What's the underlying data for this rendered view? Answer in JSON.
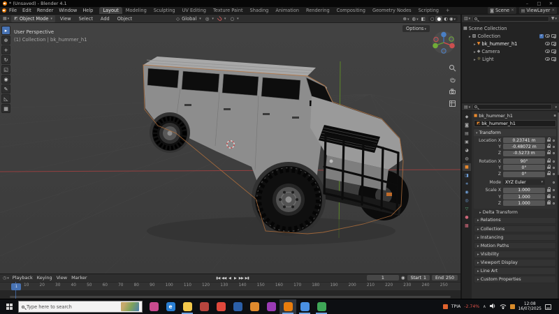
{
  "window": {
    "title": "* (Unsaved) - Blender 4.1",
    "controls": {
      "minimize": "–",
      "maximize": "□",
      "close": "✕"
    }
  },
  "menubar": {
    "menus": [
      {
        "label": "File"
      },
      {
        "label": "Edit"
      },
      {
        "label": "Render"
      },
      {
        "label": "Window"
      },
      {
        "label": "Help"
      }
    ],
    "workspaces": [
      {
        "label": "Layout",
        "cls": "active"
      },
      {
        "label": "Modeling"
      },
      {
        "label": "Sculpting"
      },
      {
        "label": "UV Editing"
      },
      {
        "label": "Texture Paint"
      },
      {
        "label": "Shading"
      },
      {
        "label": "Animation"
      },
      {
        "label": "Rendering"
      },
      {
        "label": "Compositing"
      },
      {
        "label": "Geometry Nodes"
      },
      {
        "label": "Scripting"
      },
      {
        "label": "+",
        "cls": "plus"
      }
    ],
    "scene_label": "Scene",
    "viewlayer_label": "ViewLayer"
  },
  "viewport_header": {
    "mode": "Object Mode",
    "menus": [
      {
        "label": "View"
      },
      {
        "label": "Select"
      },
      {
        "label": "Add"
      },
      {
        "label": "Object"
      }
    ],
    "orientation": "Global"
  },
  "viewport": {
    "projection": "User Perspective",
    "context": "(1) Collection | bk_hummer_h1",
    "options_label": "Options"
  },
  "toolbar": {
    "tools": [
      {
        "name": "tweak-select",
        "glyph": "▸",
        "cls": "active"
      },
      {
        "name": "cursor",
        "glyph": "⊕"
      },
      {
        "name": "move",
        "glyph": "+"
      },
      {
        "name": "rotate",
        "glyph": "↻"
      },
      {
        "name": "scale",
        "glyph": "◱"
      },
      {
        "name": "transform",
        "glyph": "◉"
      },
      {
        "name": "annotate",
        "glyph": "✎"
      },
      {
        "name": "measure",
        "glyph": "◺"
      },
      {
        "name": "add-cube",
        "glyph": "▦"
      }
    ]
  },
  "outliner": {
    "scene_collection": "Scene Collection",
    "collection": "Collection",
    "objects": [
      {
        "name": "bk_hummer_h1",
        "glyph": "▼",
        "color": "#e8882d",
        "cls": "active"
      },
      {
        "name": "Camera",
        "glyph": "◆",
        "color": "#9f9f9f"
      },
      {
        "name": "Light",
        "glyph": "☼",
        "color": "#d8c471"
      }
    ]
  },
  "properties": {
    "breadcrumb": "bk_hummer_h1",
    "object_name": "bk_hummer_h1",
    "transform_title": "Transform",
    "rows": [
      {
        "label": "Location X",
        "value": "0.23741 m"
      },
      {
        "label": "Y",
        "value": "-0.48072 m"
      },
      {
        "label": "Z",
        "value": "-0.5273 m"
      },
      {
        "label": "Rotation X",
        "value": "90°",
        "cls": "gap"
      },
      {
        "label": "Y",
        "value": "0°"
      },
      {
        "label": "Z",
        "value": "0°"
      },
      {
        "label": "Mode",
        "value": "XYZ Euler",
        "cls": "gap nolock",
        "fieldcls": "dropdown"
      },
      {
        "label": "Scale X",
        "value": "1.000",
        "cls": "gap"
      },
      {
        "label": "Y",
        "value": "1.000"
      },
      {
        "label": "Z",
        "value": "1.000"
      }
    ],
    "subpanel": "Delta Transform",
    "panels": [
      {
        "label": "Relations"
      },
      {
        "label": "Collections"
      },
      {
        "label": "Instancing"
      },
      {
        "label": "Motion Paths"
      },
      {
        "label": "Visibility"
      },
      {
        "label": "Viewport Display"
      },
      {
        "label": "Line Art"
      },
      {
        "label": "Custom Properties"
      }
    ],
    "tabs": [
      {
        "name": "tool",
        "glyph": "◆",
        "color": "#a8a8a8"
      },
      {
        "name": "render",
        "glyph": "◙",
        "color": "#a8a8a8"
      },
      {
        "name": "output",
        "glyph": "▤",
        "color": "#a8a8a8"
      },
      {
        "name": "view-layer",
        "glyph": "▣",
        "color": "#a8a8a8"
      },
      {
        "name": "scene",
        "glyph": "◕",
        "color": "#a8a8a8"
      },
      {
        "name": "world",
        "glyph": "◍",
        "color": "#a8a8a8"
      },
      {
        "name": "object",
        "glyph": "■",
        "color": "#e8882d",
        "cls": "active"
      },
      {
        "name": "modifiers",
        "glyph": "◨",
        "color": "#6f9fd8"
      },
      {
        "name": "particles",
        "glyph": "∗",
        "color": "#6f9fd8"
      },
      {
        "name": "physics",
        "glyph": "◉",
        "color": "#6f9fd8"
      },
      {
        "name": "constraints",
        "glyph": "◎",
        "color": "#6f9fd8"
      },
      {
        "name": "object-data",
        "glyph": "▽",
        "color": "#58b27c"
      },
      {
        "name": "material",
        "glyph": "●",
        "color": "#cf6679"
      },
      {
        "name": "texture",
        "glyph": "▩",
        "color": "#cf6679"
      }
    ]
  },
  "timeline": {
    "menus": [
      {
        "label": "Playback"
      },
      {
        "label": "Keying"
      },
      {
        "label": "View"
      },
      {
        "label": "Marker"
      }
    ],
    "controls": [
      {
        "name": "jump-to-start",
        "glyph": "▮◀"
      },
      {
        "name": "prev-keyframe",
        "glyph": "◀◀"
      },
      {
        "name": "play-reverse",
        "glyph": "◀"
      },
      {
        "name": "play",
        "glyph": "▶"
      },
      {
        "name": "next-keyframe",
        "glyph": "▶▶"
      },
      {
        "name": "jump-to-end",
        "glyph": "▶▮"
      }
    ],
    "current_frame": "1",
    "playhead_frame": "1",
    "start_label": "Start",
    "start_value": "1",
    "end_label": "End",
    "end_value": "250",
    "ticks": [
      "10",
      "20",
      "30",
      "40",
      "50",
      "60",
      "70",
      "80",
      "90",
      "100",
      "110",
      "120",
      "130",
      "140",
      "150",
      "160",
      "170",
      "180",
      "190",
      "200",
      "210",
      "220",
      "230",
      "240",
      "250"
    ]
  },
  "taskbar": {
    "search_placeholder": "Type here to search",
    "apps": [
      {
        "name": "photos",
        "color": "#c84b8f"
      },
      {
        "name": "edge",
        "color": "#2a7fd4",
        "glyph": "e"
      },
      {
        "name": "file-explorer",
        "color": "#f3c84b",
        "cls": "running"
      },
      {
        "name": "media-player",
        "color": "#b8453e"
      },
      {
        "name": "chrome",
        "color": "#e0483c"
      },
      {
        "name": "app-blue",
        "color": "#2b5fa8"
      },
      {
        "name": "app-orange",
        "color": "#e08a2d"
      },
      {
        "name": "adobe-app",
        "color": "#9a3bb5"
      },
      {
        "name": "blender",
        "color": "#e87d0d",
        "cls": "running active"
      },
      {
        "name": "chrome-profile-1",
        "color": "#4a90e2",
        "cls": "running"
      },
      {
        "name": "chrome-profile-2",
        "color": "#3fa757",
        "cls": "running"
      }
    ],
    "tray": {
      "ticker": "TPIA",
      "change": "-2.74%",
      "time": "12:08",
      "date": "16/07/2025"
    }
  },
  "colors": {
    "accent": "#4772b3",
    "blender_orange": "#e87d0d",
    "axis_x": "#9e4040",
    "axis_y": "#5f8f26"
  }
}
